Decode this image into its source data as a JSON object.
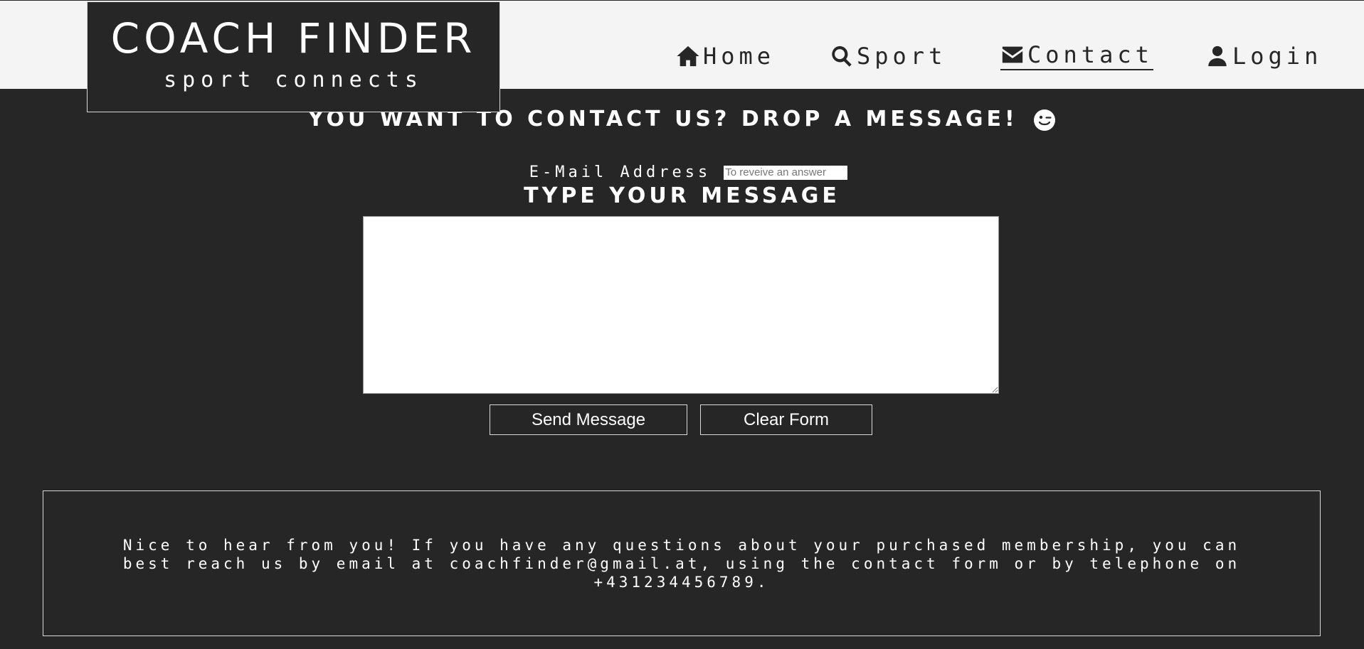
{
  "logo": {
    "title": "COACH FINDER",
    "subtitle": "sport connects"
  },
  "nav": {
    "items": [
      {
        "label": "Home",
        "icon": "home-icon"
      },
      {
        "label": "Sport",
        "icon": "search-icon"
      },
      {
        "label": "Contact",
        "icon": "envelope-icon",
        "active": true
      },
      {
        "label": "Login",
        "icon": "user-icon"
      }
    ]
  },
  "main": {
    "title": "YOU WANT TO CONTACT US? DROP A MESSAGE!",
    "title_icon": "wink-emoji-icon",
    "email_label": "E-Mail Address",
    "email_placeholder": "To reveive an answer",
    "email_value": "",
    "message_heading": "TYPE YOUR MESSAGE",
    "message_value": "",
    "send_label": "Send Message",
    "clear_label": "Clear Form"
  },
  "info": {
    "text": "Nice to hear from you! If you have any questions about your purchased membership, you can best reach us by email at coachfinder@gmail.at, using the contact form or by telephone on +431234456789."
  },
  "colors": {
    "background": "#262626",
    "header": "#f4f4f4",
    "text": "#ffffff",
    "border": "#d9d9d9"
  }
}
